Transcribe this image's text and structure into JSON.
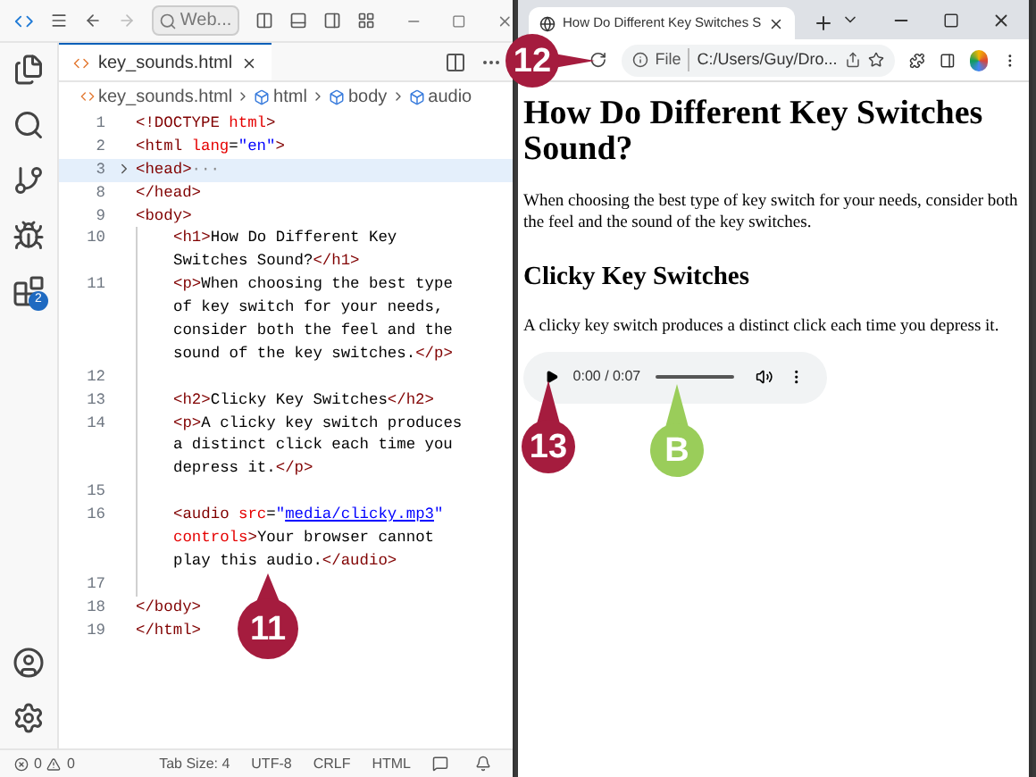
{
  "editor": {
    "search": "Web...",
    "extensions_badge": "2",
    "tabs": [
      {
        "label": "key_sounds.html",
        "selected": true
      }
    ],
    "breadcrumb": [
      "key_sounds.html",
      "html",
      "body",
      "audio"
    ],
    "lines": [
      {
        "number": "1",
        "indented": false,
        "folded": false,
        "highlighted": false,
        "wraps": [
          [
            {
              "kind": "tag",
              "text": "<!DOCTYPE "
            },
            {
              "kind": "attr",
              "text": "html"
            },
            {
              "kind": "tag",
              "text": ">"
            }
          ]
        ]
      },
      {
        "number": "2",
        "indented": false,
        "folded": false,
        "highlighted": false,
        "wraps": [
          [
            {
              "kind": "tag",
              "text": "<html "
            },
            {
              "kind": "attr",
              "text": "lang"
            },
            {
              "kind": "text",
              "text": "="
            },
            {
              "kind": "str",
              "text": "\"en\""
            },
            {
              "kind": "tag",
              "text": ">"
            }
          ]
        ]
      },
      {
        "number": "3",
        "indented": false,
        "folded": true,
        "highlighted": true,
        "wraps": [
          [
            {
              "kind": "tag",
              "text": "<head>"
            },
            {
              "kind": "dim",
              "text": "···"
            }
          ]
        ]
      },
      {
        "number": "8",
        "indented": false,
        "folded": false,
        "highlighted": false,
        "wraps": [
          [
            {
              "kind": "tag",
              "text": "</head>"
            }
          ]
        ]
      },
      {
        "number": "9",
        "indented": false,
        "folded": false,
        "highlighted": false,
        "wraps": [
          [
            {
              "kind": "tag",
              "text": "<body>"
            }
          ]
        ]
      },
      {
        "number": "10",
        "indented": true,
        "folded": false,
        "highlighted": false,
        "wraps": [
          [
            {
              "kind": "tag",
              "text": "<h1>"
            },
            {
              "kind": "text",
              "text": "How Do Different Key"
            }
          ],
          [
            {
              "kind": "text",
              "text": "Switches Sound?"
            },
            {
              "kind": "tag",
              "text": "</h1>"
            }
          ]
        ]
      },
      {
        "number": "11",
        "indented": true,
        "folded": false,
        "highlighted": false,
        "wraps": [
          [
            {
              "kind": "tag",
              "text": "<p>"
            },
            {
              "kind": "text",
              "text": "When choosing the best type"
            }
          ],
          [
            {
              "kind": "text",
              "text": "of key switch for your needs,"
            }
          ],
          [
            {
              "kind": "text",
              "text": "consider both the feel and the"
            }
          ],
          [
            {
              "kind": "text",
              "text": "sound of the key switches."
            },
            {
              "kind": "tag",
              "text": "</p>"
            }
          ]
        ]
      },
      {
        "number": "12",
        "indented": true,
        "folded": false,
        "highlighted": false
      },
      {
        "number": "13",
        "indented": true,
        "folded": false,
        "highlighted": false,
        "wraps": [
          [
            {
              "kind": "tag",
              "text": "<h2>"
            },
            {
              "kind": "text",
              "text": "Clicky Key Switches"
            },
            {
              "kind": "tag",
              "text": "</h2>"
            }
          ]
        ]
      },
      {
        "number": "14",
        "indented": true,
        "folded": false,
        "highlighted": false,
        "wraps": [
          [
            {
              "kind": "tag",
              "text": "<p>"
            },
            {
              "kind": "text",
              "text": "A clicky key switch produces"
            }
          ],
          [
            {
              "kind": "text",
              "text": "a distinct click each time you"
            }
          ],
          [
            {
              "kind": "text",
              "text": "depress it."
            },
            {
              "kind": "tag",
              "text": "</p>"
            }
          ]
        ]
      },
      {
        "number": "15",
        "indented": true,
        "folded": false,
        "highlighted": false
      },
      {
        "number": "16",
        "indented": true,
        "folded": false,
        "highlighted": false,
        "wraps": [
          [
            {
              "kind": "tag",
              "text": "<audio "
            },
            {
              "kind": "attr",
              "text": "src"
            },
            {
              "kind": "text",
              "text": "="
            },
            {
              "kind": "str",
              "text": "\""
            },
            {
              "kind": "link",
              "text": "media/clicky.mp3"
            },
            {
              "kind": "str",
              "text": "\""
            }
          ],
          [
            {
              "kind": "attr",
              "text": "controls"
            },
            {
              "kind": "tag",
              "text": ">"
            },
            {
              "kind": "text",
              "text": "Your browser cannot"
            }
          ],
          [
            {
              "kind": "text",
              "text": "play this audio."
            },
            {
              "kind": "tag",
              "text": "</audio>"
            }
          ]
        ]
      },
      {
        "number": "17",
        "indented": true,
        "folded": false,
        "highlighted": false
      },
      {
        "number": "18",
        "indented": false,
        "folded": false,
        "highlighted": false,
        "wraps": [
          [
            {
              "kind": "tag",
              "text": "</body>"
            }
          ]
        ]
      },
      {
        "number": "19",
        "indented": false,
        "folded": false,
        "highlighted": false,
        "wraps": [
          [
            {
              "kind": "tag",
              "text": "</html>"
            }
          ]
        ]
      }
    ],
    "status_bar": {
      "errors": "0",
      "warnings": "0",
      "items": [
        "Tab Size: 4",
        "UTF-8",
        "CRLF",
        "HTML"
      ]
    }
  },
  "browser": {
    "tabs": [
      {
        "label": "How Do Different Key Switches S",
        "selected": true
      }
    ],
    "address": {
      "scheme": "File",
      "url": "C:/Users/Guy/Dro..."
    },
    "page": {
      "h1": "How Do Different Key Switches Sound?",
      "p1": "When choosing the best type of key switch for your needs, consider both the feel and the sound of the key switches.",
      "h2": "Clicky Key Switches",
      "p2": "A clicky key switch produces a distinct click each time you depress it.",
      "audio_time": "0:00 / 0:07"
    }
  },
  "callouts": [
    {
      "label": "11",
      "color": "#a51c3e"
    },
    {
      "label": "12",
      "color": "#a51c3e"
    },
    {
      "label": "13",
      "color": "#a51c3e"
    },
    {
      "label": "B",
      "color": "#9acd5a"
    }
  ]
}
